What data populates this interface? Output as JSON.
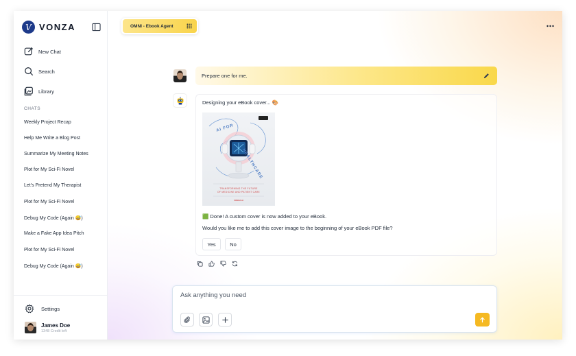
{
  "brand": {
    "name": "VONZA",
    "mark": "V"
  },
  "sidebar": {
    "nav": [
      {
        "label": "New Chat",
        "icon": "new-chat-icon"
      },
      {
        "label": "Search",
        "icon": "search-icon"
      },
      {
        "label": "Library",
        "icon": "library-icon"
      }
    ],
    "chats_label": "CHATS",
    "chats": [
      "Weekly Project Recap",
      "Help Me Write a Blog Post",
      "Summarize My Meeting Notes",
      "Plot for My Sci-Fi Novel",
      "Let's Pretend My Therapist",
      "Plot for My Sci-Fi Novel",
      "Debug My Code (Again 😅)",
      "Make a Fake App Idea Pitch",
      "Plot for My Sci-Fi Novel",
      "Debug My Code (Again 😅)"
    ],
    "settings_label": "Settings",
    "user": {
      "name": "James Doe",
      "credits": "1348 Credit left"
    }
  },
  "header": {
    "agent_label": "OMNI - Ebook Agent"
  },
  "conversation": {
    "user_message": "Prepare one for me.",
    "bot_intro": "Designing your eBook cover... 🎨",
    "cover": {
      "title_line1": "AI FOR",
      "title_line2": "HEALTHCARE",
      "subtitle_line1": "TRANSFORMING THE FUTURE",
      "subtitle_line2": "OF MEDICINE AND PATIENT CARE",
      "author": "VONZA AI"
    },
    "bot_done": "🟩 Done! A custom cover is now added to your eBook.",
    "bot_question": "Would you like me to add this cover image to the beginning of your eBook PDF file?",
    "choices": {
      "yes": "Yes",
      "no": "No"
    }
  },
  "composer": {
    "placeholder": "Ask anything you need"
  },
  "colors": {
    "accent": "#f5b922",
    "brand": "#1d3a8a",
    "user_bubble_end": "#f9d84a"
  }
}
